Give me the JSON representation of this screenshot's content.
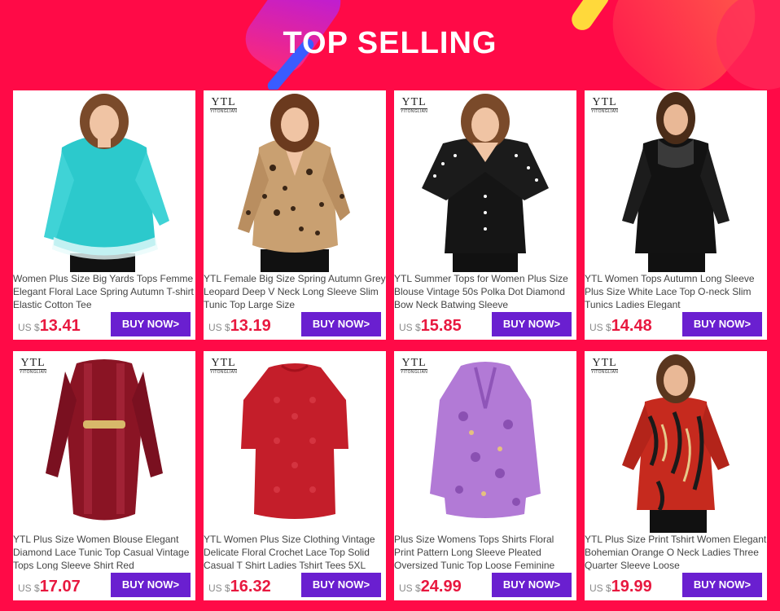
{
  "header": {
    "title": "TOP SELLING"
  },
  "brand": {
    "logo_main": "YTL",
    "logo_sub": "YITONGLIAN"
  },
  "colors": {
    "background": "#ff0a47",
    "button": "#6a1fd0",
    "price": "#e8183f"
  },
  "products": [
    {
      "description": "Women Plus Size Big Yards Tops Femme Elegant Floral Lace Spring Autumn T-shirt Elastic Cotton Tee",
      "currency": "US $",
      "price": "13.41",
      "button": "BUY NOW>",
      "has_logo": false,
      "garment": "lace-teal"
    },
    {
      "description": "YTL Female Big Size Spring Autumn Grey Leopard Deep V Neck Long Sleeve Slim Tunic Top Large Size",
      "currency": "US $",
      "price": "13.19",
      "button": "BUY NOW>",
      "has_logo": true,
      "garment": "leopard"
    },
    {
      "description": "YTL Summer Tops for Women Plus Size Blouse Vintage 50s Polka Dot Diamond Bow Neck Batwing Sleeve",
      "currency": "US $",
      "price": "15.85",
      "button": "BUY NOW>",
      "has_logo": true,
      "garment": "polka-black"
    },
    {
      "description": "YTL Women Tops Autumn Long Sleeve Plus Size White Lace Top O-neck Slim Tunics Ladies Elegant",
      "currency": "US $",
      "price": "14.48",
      "button": "BUY NOW>",
      "has_logo": true,
      "garment": "black-lace"
    },
    {
      "description": "YTL Plus Size Women Blouse Elegant Diamond Lace Tunic Top Casual Vintage Tops Long Sleeve Shirt Red",
      "currency": "US $",
      "price": "17.07",
      "button": "BUY NOW>",
      "has_logo": true,
      "garment": "burgundy-tunic"
    },
    {
      "description": "YTL Women Plus Size Clothing Vintage Delicate Floral Crochet Lace Top Solid Casual T Shirt Ladies Tshirt Tees 5XL",
      "currency": "US $",
      "price": "16.32",
      "button": "BUY NOW>",
      "has_logo": true,
      "garment": "red-crochet"
    },
    {
      "description": "Plus Size Womens Tops Shirts Floral Print Pattern Long Sleeve Pleated Oversized Tunic Top Loose Feminine",
      "currency": "US $",
      "price": "24.99",
      "button": "BUY NOW>",
      "has_logo": true,
      "garment": "purple-floral"
    },
    {
      "description": "YTL Plus Size Print Tshirt Women Elegant Bohemian Orange O Neck Ladies Three Quarter Sleeve Loose",
      "currency": "US $",
      "price": "19.99",
      "button": "BUY NOW>",
      "has_logo": true,
      "garment": "bohemian-print"
    }
  ]
}
